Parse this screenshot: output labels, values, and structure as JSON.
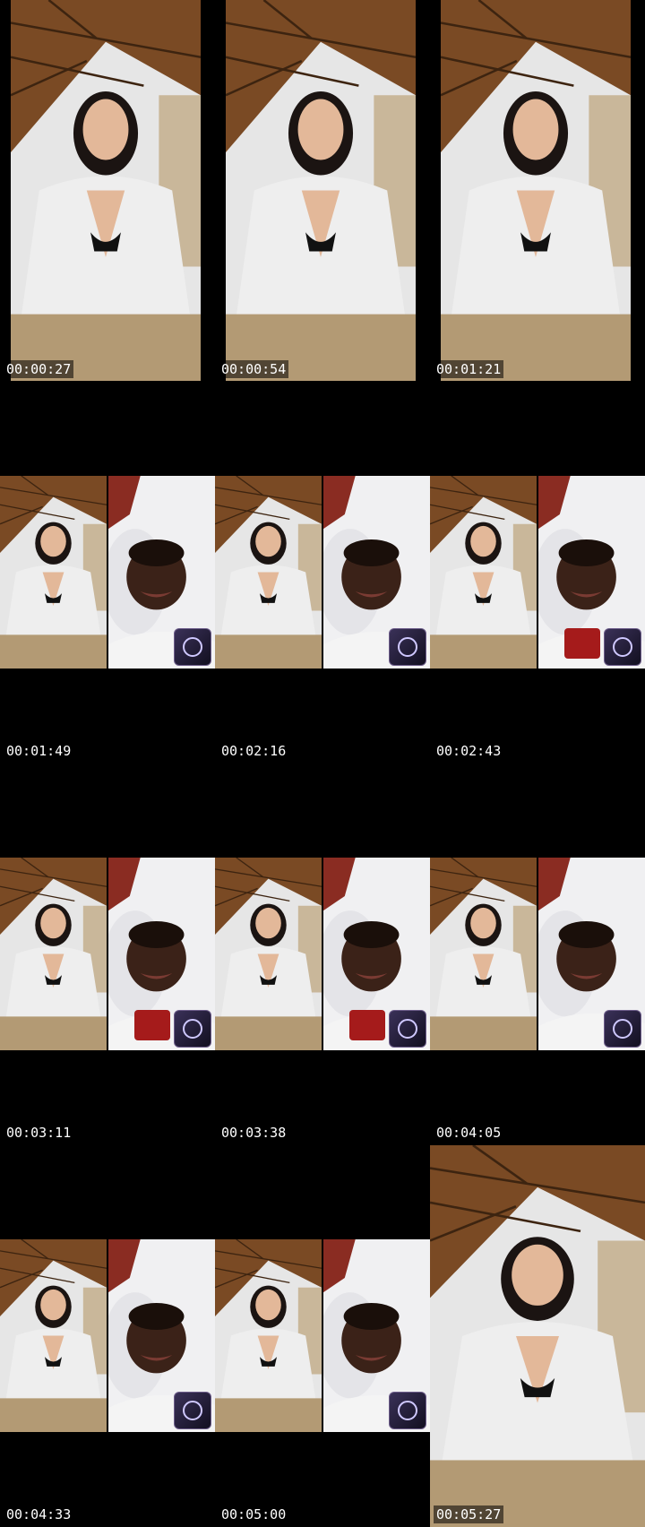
{
  "thumbnails": [
    {
      "timestamp": "00:00:27",
      "layout": "single",
      "pip": false
    },
    {
      "timestamp": "00:00:54",
      "layout": "single",
      "pip": false
    },
    {
      "timestamp": "00:01:21",
      "layout": "single",
      "pip": false
    },
    {
      "timestamp": "00:01:49",
      "layout": "split",
      "pip": true
    },
    {
      "timestamp": "00:02:16",
      "layout": "split",
      "pip": true
    },
    {
      "timestamp": "00:02:43",
      "layout": "split",
      "pip": true
    },
    {
      "timestamp": "00:03:11",
      "layout": "split",
      "pip": true
    },
    {
      "timestamp": "00:03:38",
      "layout": "split",
      "pip": true
    },
    {
      "timestamp": "00:04:05",
      "layout": "split",
      "pip": true
    },
    {
      "timestamp": "00:04:33",
      "layout": "split",
      "pip": true
    },
    {
      "timestamp": "00:05:00",
      "layout": "split",
      "pip": true
    },
    {
      "timestamp": "00:05:27",
      "layout": "single",
      "pip": false
    }
  ],
  "colors": {
    "background": "#000000",
    "timestamp_text": "#ffffff",
    "ceiling": "#7a4a24",
    "robe": "#eeeeee",
    "counter": "#b39a74",
    "wall": "#e6e6e6"
  }
}
